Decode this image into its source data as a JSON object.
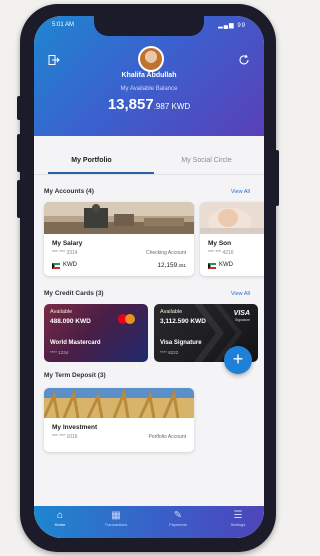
{
  "status": {
    "time": "5:01 AM",
    "right": "▂▄▆ 99"
  },
  "header": {
    "user_name": "Khalifa Abdullah",
    "balance_label": "My Available Balance",
    "balance_int": "13,857",
    "balance_dec": ".987",
    "balance_currency": " KWD",
    "logout_icon": "logout-icon",
    "refresh_icon": "refresh-icon"
  },
  "tabs": [
    {
      "label": "My Portfolio",
      "active": true
    },
    {
      "label": "My Social Circle",
      "active": false
    }
  ],
  "accounts": {
    "title": "My Accounts (4)",
    "view_all": "View All",
    "items": [
      {
        "name": "My Salary",
        "number": "*** *** 3314",
        "type": "Checking Account",
        "currency": "KWD",
        "amount": "12,159",
        "amount_dec": ".251"
      },
      {
        "name": "My Son",
        "number": "*** *** 4216",
        "type": "",
        "currency": "KWD",
        "amount": "",
        "amount_dec": ""
      }
    ]
  },
  "credit_cards": {
    "title": "My Credit Cards (3)",
    "view_all": "View All",
    "items": [
      {
        "label": "Available",
        "amount": "488.090 KWD",
        "name": "World Mastercard",
        "number": "**** 1234",
        "brand": "mastercard"
      },
      {
        "label": "Available",
        "amount": "3,112.590 KWD",
        "name": "Visa Signature",
        "number": "**** 8222",
        "brand": "VISA",
        "brand_sub": "Signature"
      }
    ]
  },
  "term_deposit": {
    "title": "My Term Deposit (3)",
    "items": [
      {
        "name": "My Investment",
        "number": "*** *** 1016",
        "type": "Portfolio Account"
      }
    ]
  },
  "fab_label": "+",
  "tabbar": [
    {
      "icon": "⌂",
      "label": "Home",
      "active": true
    },
    {
      "icon": "▦",
      "label": "Transactions",
      "active": false
    },
    {
      "icon": "✎",
      "label": "Payments",
      "active": false
    },
    {
      "icon": "☰",
      "label": "Settings",
      "active": false
    }
  ],
  "colors": {
    "accent": "#2f6cc8",
    "header_start": "#1e87cf",
    "header_end": "#5a3fb8"
  }
}
